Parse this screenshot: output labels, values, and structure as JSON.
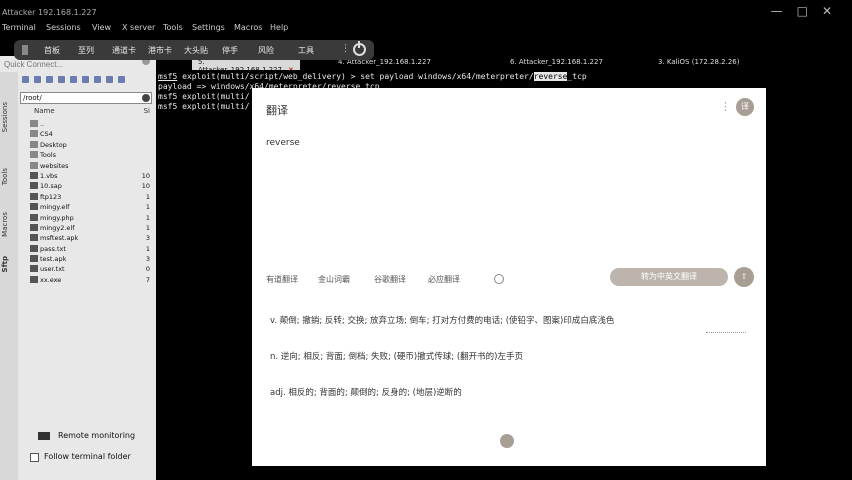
{
  "window": {
    "title": "Attacker 192.168.1.227",
    "controls": [
      "—",
      "□",
      "✕"
    ]
  },
  "menubar": [
    "Terminal",
    "Sessions",
    "View",
    "X server",
    "Tools",
    "Settings",
    "Macros",
    "Help"
  ],
  "floatbar": {
    "items": [
      "首板",
      "至列",
      "通道卡",
      "港市卡",
      "大头贴",
      "停手",
      "风险",
      "工具"
    ]
  },
  "tabs": [
    {
      "label": "5. Attacker_192.168.1.227",
      "active": true
    },
    {
      "label": "4. Attacker_192.168.1.227",
      "active": false
    },
    {
      "label": "6. Attacker_192.168.1.227",
      "active": false
    },
    {
      "label": "3. KaliOS (172.28.2.26)",
      "active": false
    }
  ],
  "sidebar": {
    "quick_connect_placeholder": "Quick Connect...",
    "vtools": [
      "Sessions",
      "Tools",
      "Macros",
      "Sftp"
    ],
    "path": "/root/",
    "columns": {
      "name": "Name",
      "size": "Si"
    },
    "files": [
      {
        "name": "..",
        "size": "",
        "dir": true
      },
      {
        "name": "CS4",
        "size": "",
        "dir": true
      },
      {
        "name": "Desktop",
        "size": "",
        "dir": true
      },
      {
        "name": "Tools",
        "size": "",
        "dir": true
      },
      {
        "name": "websites",
        "size": "",
        "dir": true
      },
      {
        "name": "1.vbs",
        "size": "10",
        "dir": false
      },
      {
        "name": "10.sap",
        "size": "10",
        "dir": false
      },
      {
        "name": "ftp123",
        "size": "1",
        "dir": false
      },
      {
        "name": "mingy.elf",
        "size": "1",
        "dir": false
      },
      {
        "name": "mingy.php",
        "size": "1",
        "dir": false
      },
      {
        "name": "mingy2.elf",
        "size": "1",
        "dir": false
      },
      {
        "name": "msftest.apk",
        "size": "3",
        "dir": false
      },
      {
        "name": "pass.txt",
        "size": "1",
        "dir": false
      },
      {
        "name": "test.apk",
        "size": "3",
        "dir": false
      },
      {
        "name": "user.txt",
        "size": "0",
        "dir": false
      },
      {
        "name": "xx.exe",
        "size": "7",
        "dir": false
      }
    ],
    "remote_monitoring": "Remote monitoring",
    "follow_terminal": "Follow terminal folder"
  },
  "terminal": {
    "line1_prompt": "msf5",
    "line1_rest": " exploit(multi/script/web_delivery) > set payload windows/x64/meterpreter/",
    "line1_hl": "reverse",
    "line1_tail": "_tcp",
    "line2": "payload => windows/x64/meterpreter/reverse_tcp",
    "line3": "msf5 exploit(multi/",
    "line4": "msf5 exploit(multi/"
  },
  "translator": {
    "title": "翻译",
    "query": "reverse",
    "engines": [
      "有道翻译",
      "金山词霸",
      "谷歌翻译",
      "必应翻译"
    ],
    "translate_button": "转为中英文翻译",
    "definitions": [
      "v. 颠倒; 撤销; 反转; 交换; 放弃立场; 倒车; 打对方付费的电话; (使铅字、图案)印成白底浅色",
      "n. 逆向; 相反; 背面; 倒档; 失败; (硬币)撤式传球; (翻开书的)左手页",
      "adj. 相反的; 背面的; 颠倒的; 反身的; (地层)逆断的"
    ],
    "accent_color": "#a89e94"
  }
}
